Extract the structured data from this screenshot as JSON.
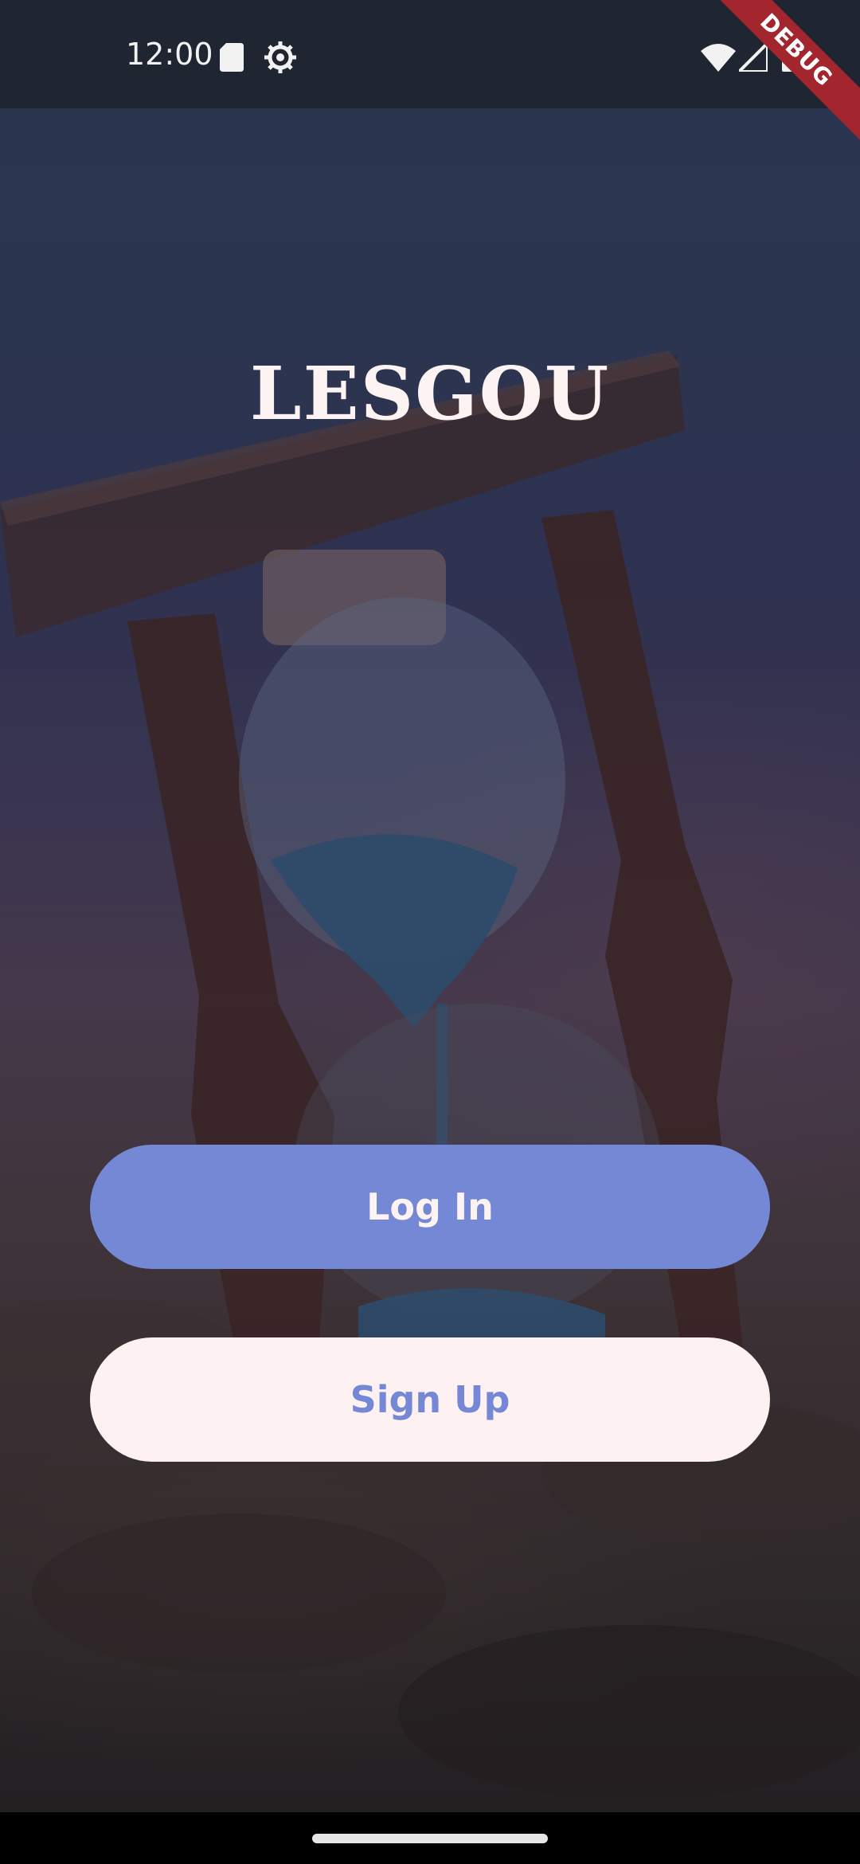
{
  "status_bar": {
    "time": "12:00",
    "icons": [
      "sd-card-icon",
      "gear-icon",
      "wifi-icon",
      "signal-icon",
      "battery-icon"
    ],
    "debug_label": "DEBUG"
  },
  "app": {
    "title": "LESGOU"
  },
  "actions": {
    "login_label": "Log In",
    "signup_label": "Sign Up"
  },
  "colors": {
    "primary": "#7588d6",
    "light": "#fdf1f1",
    "debug_ribbon": "#a3262e"
  }
}
